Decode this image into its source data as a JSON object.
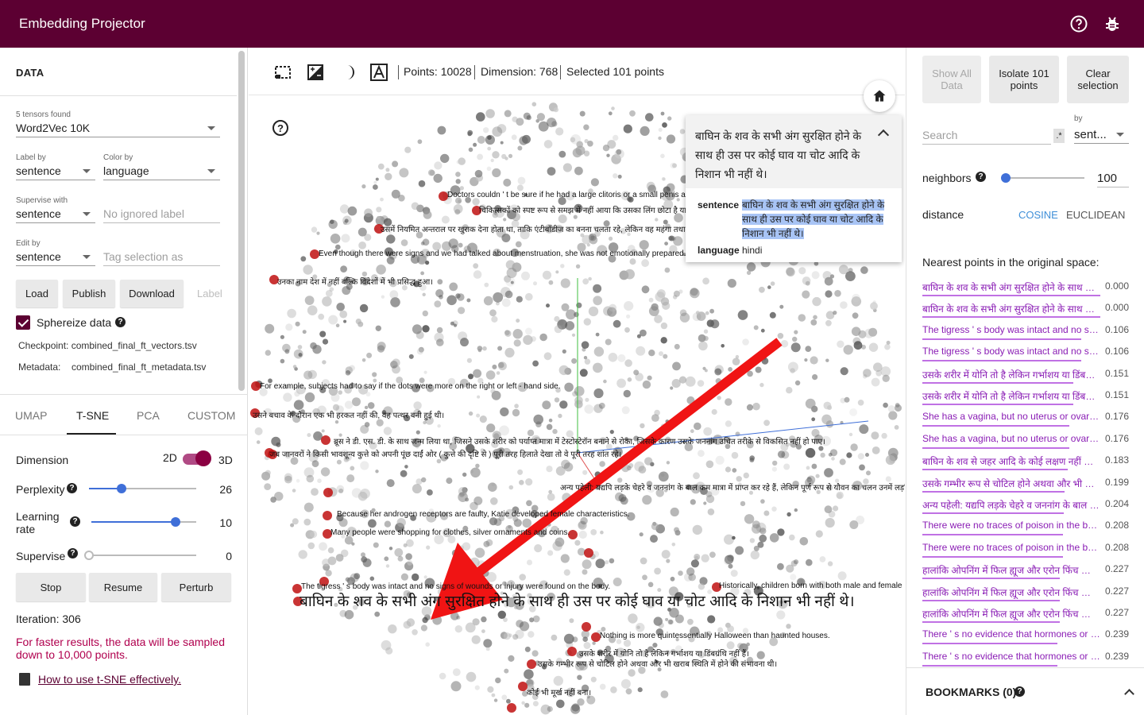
{
  "app": {
    "title": "Embedding Projector",
    "help_icon": "help-circle-icon",
    "bug_icon": "bug-icon"
  },
  "data_panel": {
    "heading": "DATA",
    "tensors_found": "5 tensors found",
    "tensor": "Word2Vec 10K",
    "label_by_caption": "Label by",
    "label_by": "sentence",
    "color_by_caption": "Color by",
    "color_by": "language",
    "supervise_caption": "Supervise with",
    "supervise_with": "sentence",
    "ignored_placeholder": "No ignored label",
    "edit_by_caption": "Edit by",
    "edit_by": "sentence",
    "tag_placeholder": "Tag selection as",
    "load_label": "Load",
    "publish_label": "Publish",
    "download_label": "Download",
    "label_label": "Label",
    "sphereize_label": "Sphereize data",
    "checkpoint": "Checkpoint: combined_final_ft_vectors.tsv",
    "metadata_caption": "Metadata:",
    "metadata": "combined_final_ft_metadata.tsv"
  },
  "tabs": [
    "UMAP",
    "T-SNE",
    "PCA",
    "CUSTOM"
  ],
  "tsne": {
    "dimension_label": "Dimension",
    "dim_2d": "2D",
    "dim_3d": "3D",
    "perplexity_label": "Perplexity",
    "perplexity": "26",
    "perplexity_frac": 0.3,
    "learning_rate_label": "Learning rate",
    "learning_rate": "10",
    "learning_rate_frac": 0.8,
    "supervise_label": "Supervise",
    "supervise": "0",
    "supervise_frac": 0.0,
    "stop_label": "Stop",
    "resume_label": "Resume",
    "perturb_label": "Perturb",
    "iteration": "Iteration: 306",
    "warning": "For faster results, the data will be sampled down to 10,000 points.",
    "link": "How to use t-SNE effectively."
  },
  "toolbar": {
    "points": "Points: 10028",
    "dimension": "Dimension: 768",
    "selected": "Selected 101 points"
  },
  "point_labels": [
    "Doctors couldn ' t be sure if he had a large clitoris or a small penis and were convinced he could not successfully live life as a",
    "चिकित्सकों को स्पष्ट रूप से समझ में नहीं आया कि उसका लिंग छोटा है या",
    "उसमें नियमित अन्तराल पर खुराक देना होता था, ताकि एंटीबॉडीज का बनना चलता रहे, लेकिन वह महंगा तथा अव्यवहारिक था।",
    "Even though there were signs and we had talked about menstruation, she was not emotionally prepared.",
    "उनका नाम देश में नहीं बल्कि विदेशों में भी प्रसिद्ध हुआ।",
    "For example, subjects had to say if the dots were more on the right or left - hand side.",
    "उसने बचाव के दौरान एक भी हरकत नहीं की, वह पत्थर बनी हुई थी।",
    "ब्रूस ने डी. एस. डी. के साथ जन्म लिया था, जिसने उसके शरीर को पर्याप्त मात्रा में टेस्टोस्टेरॉन बनाने से रोका, जिसके कारण उसके जननांग उचित तरीके से विकसित नहीं हो पाए।",
    "जब जानवरों ने किसी भावशून्य कुत्ते को अपनी पूंछ दाईं ओर ( कुत्ते की दृष्टि से ) पूरी तरह हिलाते देखा तो वे पूरी तरह शांत रहे।",
    "अन्य पहेली: यद्यपि लड़के चेहरे व जननांग के बाल कम मात्रा में प्राप्त कर रहे हैं, लेकिन पूर्ण रूप से यौवन का चलन उनमें लड़कियों",
    "Because her androgen receptors are faulty, Katie developed female characteristics.",
    "Many people were shopping for clothes, silver ornaments and coins.",
    "The tigress ' s body was intact and no signs of wounds or injury were found on the body.",
    "बाघिन के शव के सभी अंग सुरक्षित होने के साथ ही उस पर कोई घाव या चोट आदि के निशान भी नहीं थे।",
    "Historically, children born with both male and female",
    "Nothing is more quintessentially Halloween than haunted houses.",
    "उसके शरीर में योनि तो है लेकिन गर्भाशय या डिंबग्रंथि नहीं हैं।",
    "उसके गम्भीर रूप से चोटिल होने अथवा और भी खराब स्थिति में होने की संभावना थी।",
    "कोई भी मूर्ख नहीं बना।"
  ],
  "inspector_card": {
    "title": "बाघिन के शव के सभी अंग सुरक्षित होने के साथ ही उस पर कोई घाव या चोट आदि के निशान भी नहीं थे।",
    "sentence_key": "sentence",
    "sentence": "बाघिन के शव के सभी अंग सुरक्षित होने के साथ ही उस पर कोई घाव या चोट आदि के निशान भी नहीं थे।",
    "language_key": "language",
    "language": "hindi"
  },
  "inspector": {
    "show_all": "Show All Data",
    "isolate": "Isolate 101 points",
    "clear": "Clear selection",
    "search_placeholder": "Search",
    "regex": ".*",
    "by_caption": "by",
    "by": "sent...",
    "neighbors_label": "neighbors",
    "neighbors": "100",
    "neighbors_frac": 0.05,
    "distance_label": "distance",
    "cosine": "COSINE",
    "euclidean": "EUCLIDEAN",
    "nearest_heading": "Nearest points in the original space:",
    "nearest": [
      {
        "text": "बाघिन के शव के सभी अंग सुरक्षित होने के साथ ही उस पर कोई",
        "score": "0.000"
      },
      {
        "text": "बाघिन के शव के सभी अंग सुरक्षित होने के साथ ही उस पर कोई",
        "score": "0.000"
      },
      {
        "text": "The tigress ' s body was intact and no signs of wounds",
        "score": "0.106"
      },
      {
        "text": "The tigress ' s body was intact and no signs of wounds",
        "score": "0.106"
      },
      {
        "text": "उसके शरीर में योनि तो है लेकिन गर्भाशय या डिंबग्रंथि नहीं हैं।",
        "score": "0.151"
      },
      {
        "text": "उसके शरीर में योनि तो है लेकिन गर्भाशय या डिंबग्रंथि नहीं हैं।",
        "score": "0.151"
      },
      {
        "text": "She has a vagina, but no uterus or ovaries.",
        "score": "0.176"
      },
      {
        "text": "She has a vagina, but no uterus or ovaries.",
        "score": "0.176"
      },
      {
        "text": "बाघिन के शव से जहर आदि के कोई लक्षण नहीं मिले।",
        "score": "0.183"
      },
      {
        "text": "उसके गम्भीर रूप से चोटिल होने अथवा और भी खराब स्थिति",
        "score": "0.199"
      },
      {
        "text": "अन्य पहेली: यद्यपि लड़के चेहरे व जननांग के बाल कम मात्रा",
        "score": "0.204"
      },
      {
        "text": "There were no traces of poison in the body.",
        "score": "0.208"
      },
      {
        "text": "There were no traces of poison in the body.",
        "score": "0.208"
      },
      {
        "text": "हालांकि ओपनिंग में फिल ह्यूज और एरोन फिंच कोई बड़ी साझेदारी",
        "score": "0.227"
      },
      {
        "text": "हालांकि ओपनिंग में फिल ह्यूज और एरोन फिंच कोई बड़ी साझेदारी",
        "score": "0.227"
      },
      {
        "text": "हालांकि ओपनिंग में फिल ह्यूज और एरोन फिंच कोई बड़ी साझेदारी",
        "score": "0.227"
      },
      {
        "text": "There ' s no evidence that hormones or environment",
        "score": "0.239"
      },
      {
        "text": "There ' s no evidence that hormones or environment",
        "score": "0.239"
      }
    ],
    "bookmarks": "BOOKMARKS (0)"
  },
  "colors": {
    "brand": "#5c0032",
    "accent": "#3f6fd8",
    "neighbor": "#8a1db5",
    "arrow": "#f01414"
  }
}
